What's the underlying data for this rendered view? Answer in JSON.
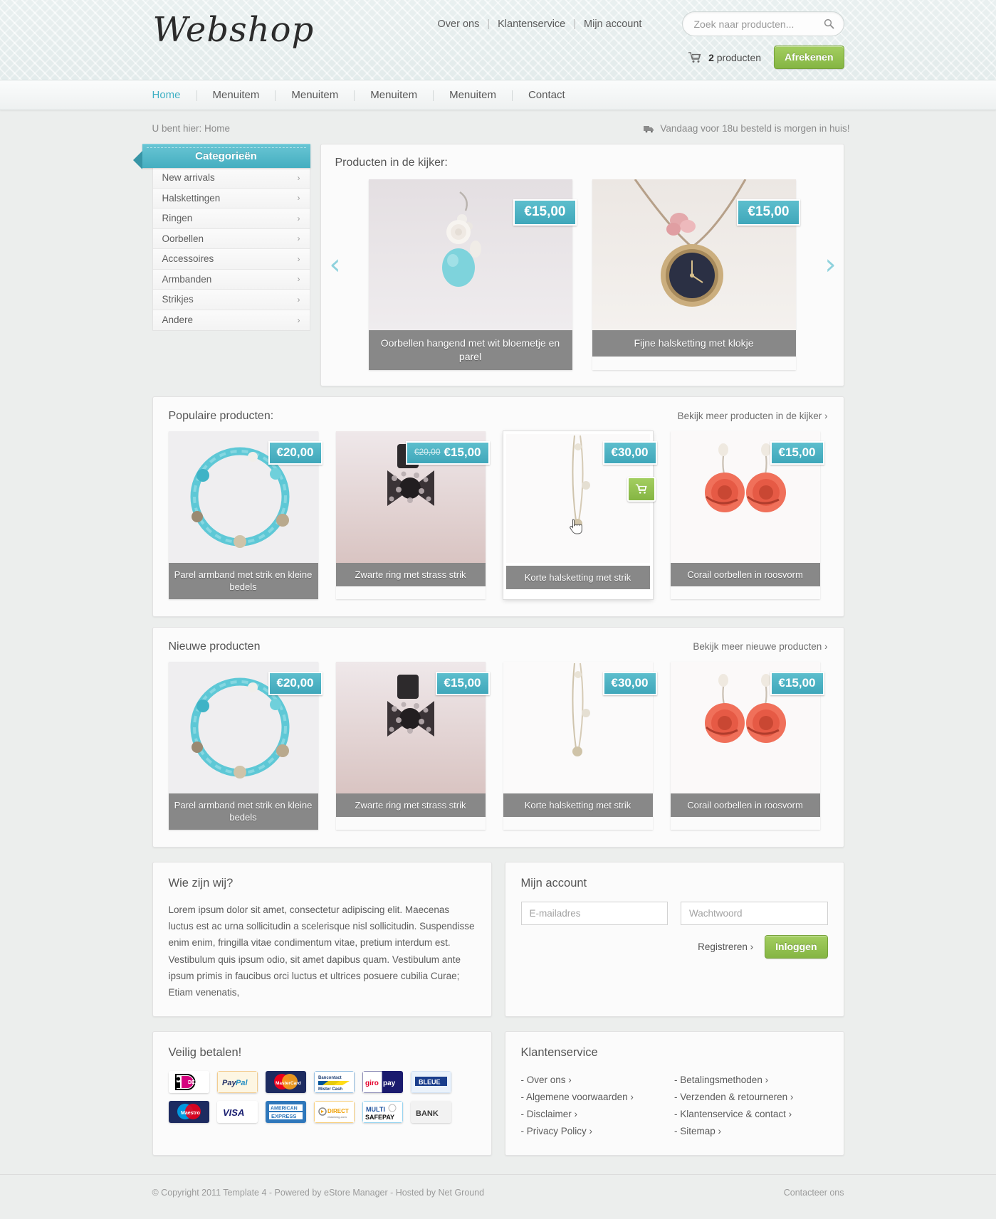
{
  "header": {
    "logo": "Webshop",
    "top_links": [
      {
        "label": "Over ons"
      },
      {
        "label": "Klantenservice"
      },
      {
        "label": "Mijn account"
      }
    ],
    "search_placeholder": "Zoek naar producten...",
    "search_value": "",
    "cart_count": "2",
    "cart_label": "producten",
    "checkout_button": "Afrekenen"
  },
  "nav": {
    "items": [
      {
        "label": "Home",
        "active": true
      },
      {
        "label": "Menuitem",
        "active": false
      },
      {
        "label": "Menuitem",
        "active": false
      },
      {
        "label": "Menuitem",
        "active": false
      },
      {
        "label": "Menuitem",
        "active": false
      },
      {
        "label": "Contact",
        "active": false
      }
    ]
  },
  "breadcrumb": "U bent hier: Home",
  "shipping_notice": "Vandaag voor 18u besteld is morgen in huis!",
  "categories": {
    "title": "Categorieën",
    "items": [
      {
        "label": "New arrivals"
      },
      {
        "label": "Halskettingen"
      },
      {
        "label": "Ringen"
      },
      {
        "label": "Oorbellen"
      },
      {
        "label": "Accessoires"
      },
      {
        "label": "Armbanden"
      },
      {
        "label": "Strikjes"
      },
      {
        "label": "Andere"
      }
    ]
  },
  "spotlight": {
    "title": "Producten in de kijker:",
    "prev_arrow": "‹",
    "next_arrow": "›",
    "slides": [
      {
        "price": "€15,00",
        "name": "Oorbellen hangend met wit bloemetje en parel"
      },
      {
        "price": "€15,00",
        "name": "Fijne halsketting met klokje"
      }
    ]
  },
  "popular": {
    "title": "Populaire producten:",
    "more_link": "Bekijk meer producten in de kijker ›",
    "products": [
      {
        "price": "€20,00",
        "old_price": "",
        "name": "Parel armband met strik en kleine bedels"
      },
      {
        "price": "€15,00",
        "old_price": "€20,00",
        "name": "Zwarte ring met strass strik"
      },
      {
        "price": "€30,00",
        "old_price": "",
        "name": "Korte halsketting met strik"
      },
      {
        "price": "€15,00",
        "old_price": "",
        "name": "Corail oorbellen in roosvorm"
      }
    ]
  },
  "newproducts": {
    "title": "Nieuwe producten",
    "more_link": "Bekijk meer nieuwe producten ›",
    "products": [
      {
        "price": "€20,00",
        "old_price": "",
        "name": "Parel armband met strik en kleine bedels"
      },
      {
        "price": "€15,00",
        "old_price": "",
        "name": "Zwarte ring met strass strik"
      },
      {
        "price": "€30,00",
        "old_price": "",
        "name": "Korte halsketting met strik"
      },
      {
        "price": "€15,00",
        "old_price": "",
        "name": "Corail oorbellen in roosvorm"
      }
    ]
  },
  "about": {
    "title": "Wie zijn wij?",
    "text": "Lorem ipsum dolor sit amet, consectetur adipiscing elit. Maecenas luctus est ac urna sollicitudin a scelerisque nisl sollicitudin. Suspendisse enim enim, fringilla vitae condimentum vitae, pretium interdum est. Vestibulum quis ipsum odio, sit amet dapibus quam. Vestibulum ante ipsum primis in faucibus orci luctus et ultrices posuere cubilia Curae; Etiam venenatis,"
  },
  "account": {
    "title": "Mijn account",
    "email_placeholder": "E-mailadres",
    "email_value": "",
    "password_placeholder": "Wachtwoord",
    "password_value": "",
    "register_link": "Registreren ›",
    "login_button": "Inloggen"
  },
  "payments": {
    "title": "Veilig betalen!",
    "methods": [
      {
        "name": "ideal",
        "label": "iDEAL"
      },
      {
        "name": "paypal",
        "label": "PayPal"
      },
      {
        "name": "mastercard",
        "label": "MasterCard"
      },
      {
        "name": "bancontact",
        "label": "Bancontact Mister Cash"
      },
      {
        "name": "giropay",
        "label": "giropay"
      },
      {
        "name": "bleue",
        "label": "BLEUE"
      },
      {
        "name": "maestro",
        "label": "Maestro"
      },
      {
        "name": "visa",
        "label": "VISA"
      },
      {
        "name": "amex",
        "label": "AMERICAN EXPRESS"
      },
      {
        "name": "directebanking",
        "label": "DIRECT ebanking.com"
      },
      {
        "name": "multisafepay",
        "label": "MULTI SAFEPAY"
      },
      {
        "name": "bank",
        "label": "BANK"
      }
    ]
  },
  "service": {
    "title": "Klantenservice",
    "left_links": [
      {
        "label": "- Over ons ›"
      },
      {
        "label": "- Algemene voorwaarden ›"
      },
      {
        "label": "- Disclaimer ›"
      },
      {
        "label": "- Privacy Policy ›"
      }
    ],
    "right_links": [
      {
        "label": "- Betalingsmethoden ›"
      },
      {
        "label": "- Verzenden & retourneren ›"
      },
      {
        "label": "- Klantenservice & contact ›"
      },
      {
        "label": "- Sitemap ›"
      }
    ]
  },
  "footer": {
    "copyright": "© Copyright 2011 Template 4 - Powered by eStore Manager - Hosted by Net Ground",
    "contact": "Contacteer ons"
  },
  "colors": {
    "accent_teal": "#45aec0",
    "accent_green": "#85b543",
    "page_bg": "#eceeed"
  }
}
